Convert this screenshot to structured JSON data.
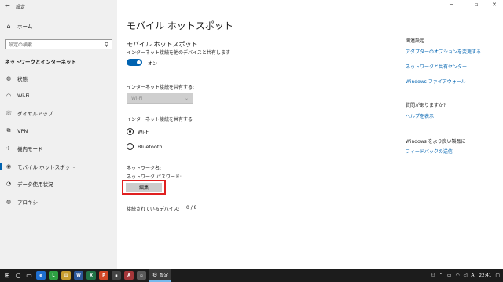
{
  "window": {
    "title": "設定",
    "minimize": "─",
    "maximize": "▫",
    "close": "✕"
  },
  "sidebar": {
    "home_label": "ホーム",
    "search_placeholder": "設定の検索",
    "section_title": "ネットワークとインターネット",
    "items": [
      {
        "label": "状態",
        "icon": "globe-icon"
      },
      {
        "label": "Wi-Fi",
        "icon": "wifi-icon"
      },
      {
        "label": "ダイヤルアップ",
        "icon": "phone-icon"
      },
      {
        "label": "VPN",
        "icon": "vpn-icon"
      },
      {
        "label": "機内モード",
        "icon": "airplane-icon"
      },
      {
        "label": "モバイル ホットスポット",
        "icon": "hotspot-icon"
      },
      {
        "label": "データ使用状況",
        "icon": "data-usage-icon"
      },
      {
        "label": "プロキシ",
        "icon": "globe-icon"
      }
    ]
  },
  "main": {
    "page_title": "モバイル ホットスポット",
    "section_heading": "モバイル ホットスポット",
    "share_desc": "インターネット接続を他のデバイスと共有します",
    "toggle_label": "オン",
    "share_from_label": "インターネット接続を共有する:",
    "share_from_value": "Wi-Fi",
    "share_over_label": "インターネット接続を共有する",
    "radio_wifi": "Wi-Fi",
    "radio_bluetooth": "Bluetooth",
    "network_name_label": "ネットワーク名:",
    "network_password_label": "ネットワーク パスワード:",
    "edit_button": "編集",
    "connected_label": "接続されているデバイス:",
    "connected_count": "0 / 8"
  },
  "right": {
    "related_heading": "関連設定",
    "link_adapter": "アダプターのオプションを変更する",
    "link_network_center": "ネットワークと共有センター",
    "link_firewall": "Windows ファイアウォール",
    "question_heading": "質問がありますか?",
    "link_help": "ヘルプを表示",
    "improve_heading": "Windows をより良い製品に",
    "link_feedback": "フィードバックの送信"
  },
  "taskbar": {
    "settings_label": "設定",
    "clock": "22:41",
    "colors": {
      "accent": "#0063b1",
      "highlight": "#e02020"
    }
  }
}
